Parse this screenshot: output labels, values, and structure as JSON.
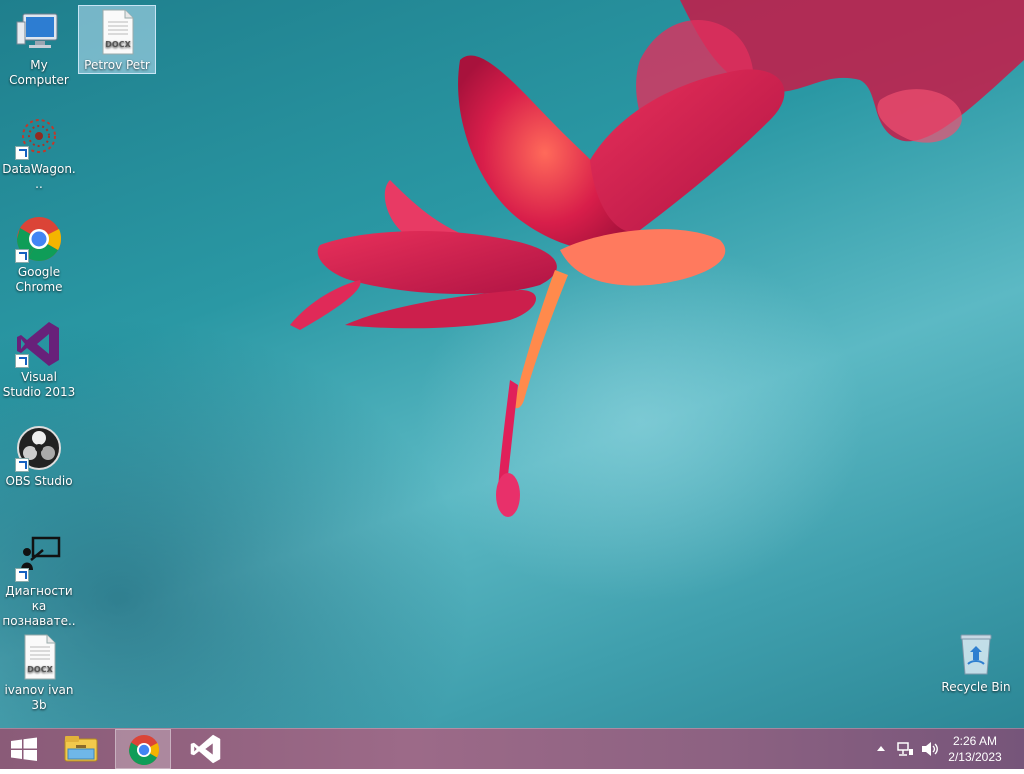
{
  "desktop": {
    "icons": [
      {
        "label": "My Computer",
        "icon": "computer-icon"
      },
      {
        "label": "Petrov Petr",
        "icon": "docx-file-icon",
        "file_tag": "DOCX"
      },
      {
        "label": "DataWagon...",
        "icon": "datawagon-icon"
      },
      {
        "label": "Google Chrome",
        "icon": "chrome-icon"
      },
      {
        "label": "Visual Studio 2013",
        "icon": "visual-studio-icon"
      },
      {
        "label": "OBS Studio",
        "icon": "obs-studio-icon"
      },
      {
        "label": "Диагностика познавате...",
        "icon": "diagnostics-icon"
      },
      {
        "label": "ivanov ivan 3b",
        "icon": "docx-file-icon",
        "file_tag": "DOCX"
      },
      {
        "label": "Recycle Bin",
        "icon": "recycle-bin-icon"
      }
    ]
  },
  "taskbar": {
    "pinned": [
      "start-icon",
      "file-explorer-icon",
      "chrome-icon",
      "visual-studio-icon"
    ],
    "active": "chrome-icon"
  },
  "tray": {
    "icons": [
      "show-hidden-icons-chevron",
      "network-icon",
      "volume-icon"
    ],
    "time": "2:26 AM",
    "date": "2/13/2023"
  },
  "colors": {
    "wallpaper_teal": "#2a98a4",
    "flower_red": "#d81e4a",
    "taskbar_mauve": "#9c6a88"
  }
}
